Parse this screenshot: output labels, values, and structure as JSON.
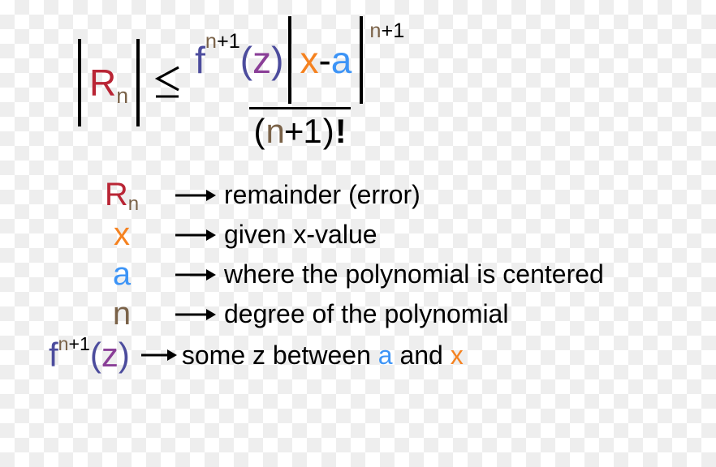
{
  "colors": {
    "red": "#b92535",
    "brown": "#7a6248",
    "orange": "#f58220",
    "blue": "#3d94f6",
    "purple_f": "#4c4c9d",
    "purple_z": "#8a3f97"
  },
  "formula": {
    "lhs": {
      "R": "R",
      "n": "n"
    },
    "rel": "≤",
    "numerator": {
      "f": "f",
      "f_exp_n": "n",
      "f_exp_plus1": "+1",
      "z_open": "(",
      "z": "z",
      "z_close": ")",
      "x": "x",
      "minus": "-",
      "a": "a",
      "outer_exp_n": "n",
      "outer_exp_plus1": "+1"
    },
    "denominator": {
      "open": "(",
      "n": "n",
      "plus1": "+1",
      "close": ")",
      "bang": "!"
    }
  },
  "legend": [
    {
      "sym_R": "R",
      "sym_n": "n",
      "desc": "remainder (error)"
    },
    {
      "sym_x": "x",
      "desc": "given x-value"
    },
    {
      "sym_a": "a",
      "desc": "where the polynomial is centered"
    },
    {
      "sym_n_only": "n",
      "desc": "degree of the polynomial"
    }
  ],
  "legend_fz": {
    "f": "f",
    "exp_n": "n",
    "exp_plus1": "+1",
    "open": "(",
    "z": "z",
    "close": ")",
    "desc_pre": "some z between ",
    "desc_a": "a",
    "desc_mid": " and ",
    "desc_x": "x"
  }
}
